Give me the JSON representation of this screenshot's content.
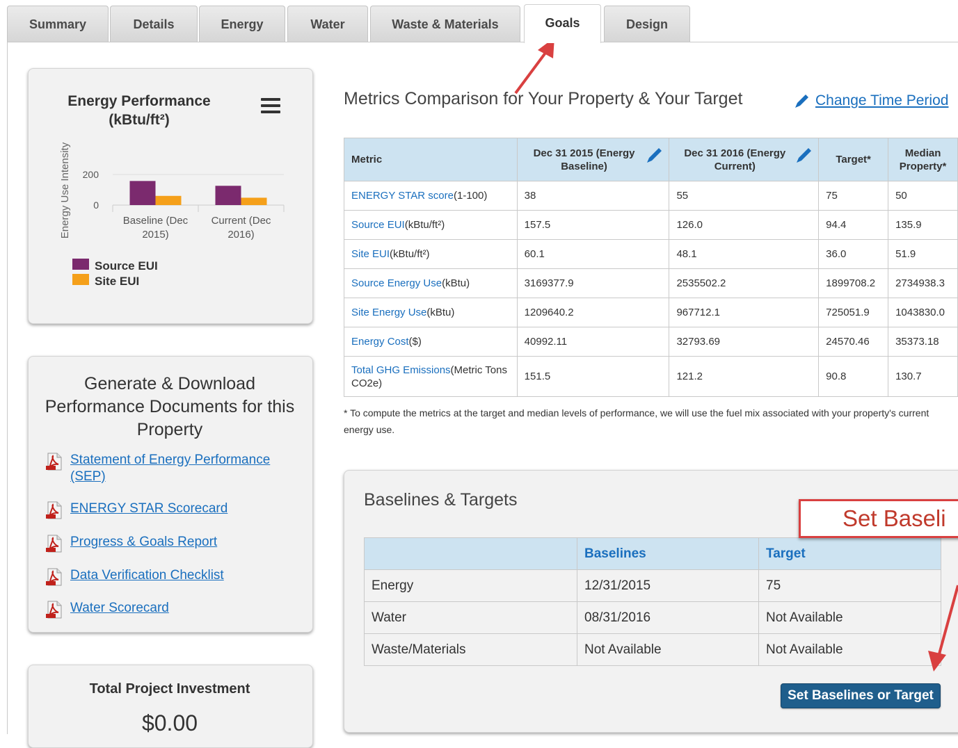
{
  "tabs": [
    "Summary",
    "Details",
    "Energy",
    "Water",
    "Waste & Materials",
    "Goals",
    "Design"
  ],
  "active_tab": "Goals",
  "chart_panel": {
    "menu_icon": "hamburger-menu-icon",
    "chart_data": {
      "type": "bar",
      "title": "Energy Performance (kBtu/ft²)",
      "ylabel": "Energy Use Intensity",
      "yticks": [
        "200",
        "0"
      ],
      "categories": [
        "Baseline (Dec 2015)",
        "Current (Dec 2016)"
      ],
      "series": [
        {
          "name": "Source EUI",
          "color": "#7b2a6e",
          "values": [
            157.5,
            126.0
          ]
        },
        {
          "name": "Site EUI",
          "color": "#f5a01a",
          "values": [
            60.1,
            48.1
          ]
        }
      ],
      "ylim": [
        0,
        200
      ],
      "legend": "bottom-left"
    }
  },
  "docs_panel": {
    "title": "Generate & Download Performance Documents for this Property",
    "items": [
      {
        "label": "Statement of Energy Performance (SEP)",
        "icon": "pdf-icon"
      },
      {
        "label": "ENERGY STAR Scorecard",
        "icon": "pdf-icon"
      },
      {
        "label": "Progress & Goals Report",
        "icon": "pdf-icon"
      },
      {
        "label": "Data Verification Checklist",
        "icon": "pdf-icon"
      },
      {
        "label": "Water Scorecard",
        "icon": "pdf-icon"
      }
    ]
  },
  "investment_panel": {
    "title": "Total Project Investment",
    "value": "$0.00"
  },
  "metrics": {
    "title": "Metrics Comparison for Your Property & Your Target",
    "change_link": "Change Time Period",
    "headers": [
      "Metric",
      "Dec 31 2015 (Energy Baseline)",
      "Dec 31 2016 (Energy Current)",
      "Target*",
      "Median Property*"
    ],
    "rows": [
      {
        "name": "ENERGY STAR score",
        "unit": "(1-100)",
        "values": [
          "38",
          "55",
          "75",
          "50"
        ]
      },
      {
        "name": "Source EUI",
        "unit": "(kBtu/ft²)",
        "values": [
          "157.5",
          "126.0",
          "94.4",
          "135.9"
        ]
      },
      {
        "name": "Site EUI",
        "unit": "(kBtu/ft²)",
        "values": [
          "60.1",
          "48.1",
          "36.0",
          "51.9"
        ]
      },
      {
        "name": "Source Energy Use",
        "unit": "(kBtu)",
        "values": [
          "3169377.9",
          "2535502.2",
          "1899708.2",
          "2734938.3"
        ]
      },
      {
        "name": "Site Energy Use",
        "unit": "(kBtu)",
        "values": [
          "1209640.2",
          "967712.1",
          "725051.9",
          "1043830.0"
        ]
      },
      {
        "name": "Energy Cost",
        "unit": "($)",
        "values": [
          "40992.11",
          "32793.69",
          "24570.46",
          "35373.18"
        ]
      },
      {
        "name": "Total GHG Emissions",
        "unit": "(Metric Tons CO2e)",
        "values": [
          "151.5",
          "121.2",
          "90.8",
          "130.7"
        ]
      }
    ],
    "footnote": "* To compute the metrics at the target and median levels of performance, we will use the fuel mix associated with your property's current energy use."
  },
  "baselines": {
    "title": "Baselines & Targets",
    "headers": [
      "",
      "Baselines",
      "Target"
    ],
    "rows": [
      [
        "Energy",
        "12/31/2015",
        "75"
      ],
      [
        "Water",
        "08/31/2016",
        "Not Available"
      ],
      [
        "Waste/Materials",
        "Not Available",
        "Not Available"
      ]
    ],
    "button": "Set Baselines or Target",
    "callout": "Set Baseli"
  },
  "colors": {
    "accent": "#1a6fbe",
    "header_bg": "#cde3f1",
    "button": "#1f5e8c",
    "annotation": "#d94040"
  }
}
